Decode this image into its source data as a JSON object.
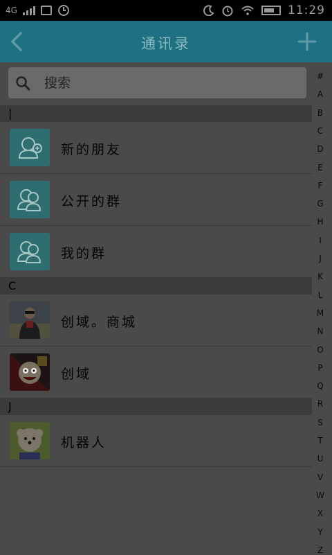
{
  "status_bar": {
    "network": "4G",
    "time": "11:29"
  },
  "header": {
    "title": "通讯录"
  },
  "search": {
    "placeholder": "搜索"
  },
  "sections": [
    {
      "letter": "|",
      "items": [
        {
          "label": "新的朋友",
          "avatar": "add-friend-icon"
        },
        {
          "label": "公开的群",
          "avatar": "group-icon"
        },
        {
          "label": "我的群",
          "avatar": "group-icon"
        }
      ]
    },
    {
      "letter": "C",
      "items": [
        {
          "label": "创域。商城",
          "avatar": "photo"
        },
        {
          "label": "创域",
          "avatar": "photo"
        }
      ]
    },
    {
      "letter": "J",
      "items": [
        {
          "label": "机器人",
          "avatar": "photo"
        }
      ]
    }
  ],
  "index": [
    "#",
    "A",
    "B",
    "C",
    "D",
    "E",
    "F",
    "G",
    "H",
    "I",
    "J",
    "K",
    "L",
    "M",
    "N",
    "O",
    "P",
    "Q",
    "R",
    "S",
    "T",
    "U",
    "V",
    "W",
    "X",
    "Y",
    "Z"
  ],
  "colors": {
    "accent": "#1d7182",
    "avatar_bg": "#2f6e70",
    "overlay_bg": "#4a4a4a"
  }
}
